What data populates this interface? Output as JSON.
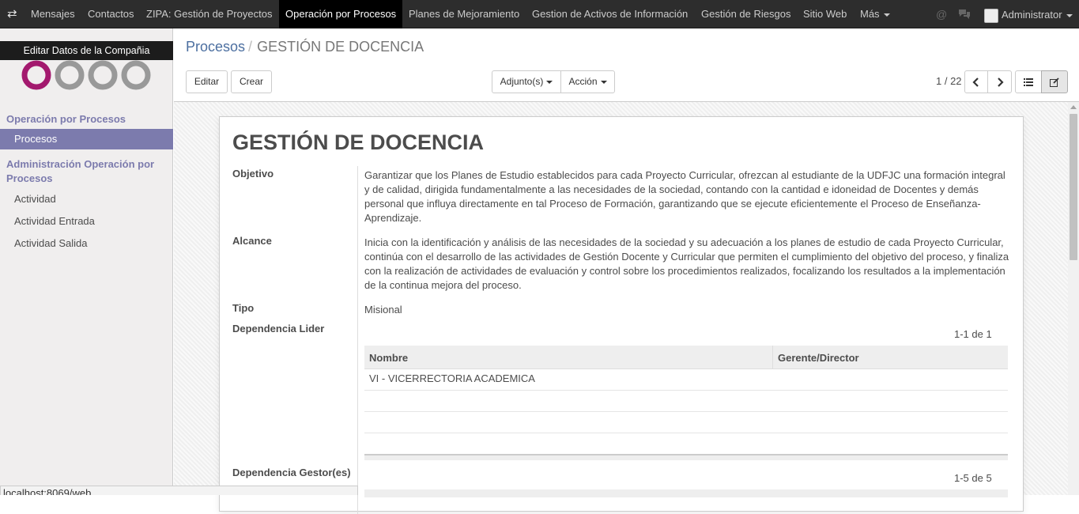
{
  "topbar": {
    "menu_icon": "exchange-icon",
    "items": [
      {
        "label": "Mensajes"
      },
      {
        "label": "Contactos"
      },
      {
        "label": "ZIPA: Gestión de Proyectos"
      },
      {
        "label": "Operación por Procesos",
        "active": true
      },
      {
        "label": "Planes de Mejoramiento"
      },
      {
        "label": "Gestion de Activos de Información"
      },
      {
        "label": "Gestión de Riesgos"
      },
      {
        "label": "Sitio Web"
      }
    ],
    "more_label": "Más",
    "user_label": "Administrator"
  },
  "sidebar": {
    "tooltip": "Editar Datos de la Compañia",
    "section1_title": "Operación por Procesos",
    "section1_items": [
      {
        "label": "Procesos",
        "active": true
      }
    ],
    "section2_title": "Administración Operación por Procesos",
    "section2_items": [
      {
        "label": "Actividad"
      },
      {
        "label": "Actividad Entrada"
      },
      {
        "label": "Actividad Salida"
      }
    ]
  },
  "breadcrumb": {
    "parent": "Procesos",
    "separator": "/",
    "current": "GESTIÓN DE DOCENCIA"
  },
  "toolbar": {
    "edit_label": "Editar",
    "create_label": "Crear",
    "attachments_label": "Adjunto(s)",
    "action_label": "Acción",
    "pager": "1 / 22"
  },
  "record": {
    "title": "GESTIÓN DE DOCENCIA",
    "objetivo_label": "Objetivo",
    "objetivo_value": "Garantizar que los Planes de Estudio establecidos para cada Proyecto Curricular, ofrezcan al estudiante de la UDFJC una formación integral y de calidad, dirigida fundamentalmente a las necesidades de la sociedad, contando con la cantidad e idoneidad de Docentes y demás personal que influya directamente en tal Proceso de Formación, garantizando que se ejecute eficientemente el Proceso de Enseñanza-Aprendizaje.",
    "alcance_label": "Alcance",
    "alcance_value": "Inicia con la identificación y análisis de las necesidades de la sociedad y su adecuación a los planes de estudio de cada Proyecto Curricular, continúa con el desarrollo de las actividades de Gestión Docente y Curricular que permiten el cumplimiento del objetivo del proceso, y finaliza con la realización de actividades de evaluación y control sobre los procedimientos realizados, focalizando los resultados a la implementación de la continua mejora del proceso.",
    "tipo_label": "Tipo",
    "tipo_value": "Misional",
    "dep_lider_label": "Dependencia Lider",
    "dep_lider_count": "1-1 de 1",
    "dep_lider_columns": [
      "Nombre",
      "Gerente/Director"
    ],
    "dep_lider_rows": [
      [
        "VI - VICERRECTORIA ACADEMICA",
        ""
      ]
    ],
    "dep_gestor_label": "Dependencia Gestor(es)",
    "dep_gestor_count": "1-5 de 5"
  },
  "statusbar": {
    "url": "localhost:8069/web"
  }
}
